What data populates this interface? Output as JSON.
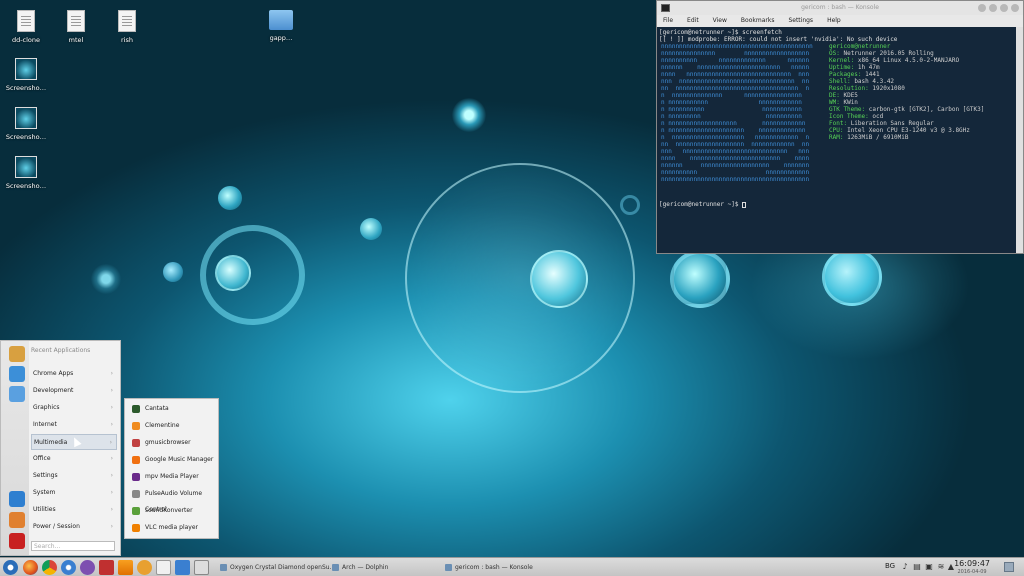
{
  "desktop": {
    "icons": [
      {
        "label": "dd-clone",
        "kind": "document"
      },
      {
        "label": "mtel",
        "kind": "document"
      },
      {
        "label": "rish",
        "kind": "document"
      },
      {
        "label": "gapp…",
        "kind": "folder"
      },
      {
        "label": "Screensho…",
        "kind": "screenshot"
      },
      {
        "label": "Screensho…",
        "kind": "screenshot"
      },
      {
        "label": "Screensho…",
        "kind": "screenshot"
      }
    ]
  },
  "konsole": {
    "title": "gericom : bash — Konsole",
    "menu": [
      "File",
      "Edit",
      "View",
      "Bookmarks",
      "Settings",
      "Help"
    ],
    "prompt_line": "[gericom@netrunner ~]$ screenfetch",
    "error_line": "[[ ! ]] modprobe: ERROR: could not insert 'nvidia': No such device",
    "user_host": "gericom@netrunner",
    "info": [
      {
        "key": "OS:",
        "value": "Netrunner 2016.05 Rolling"
      },
      {
        "key": "Kernel:",
        "value": "x86_64 Linux 4.5.0-2-MANJARO"
      },
      {
        "key": "Uptime:",
        "value": "1h 47m"
      },
      {
        "key": "Packages:",
        "value": "1441"
      },
      {
        "key": "Shell:",
        "value": "bash 4.3.42"
      },
      {
        "key": "Resolution:",
        "value": "1920x1080"
      },
      {
        "key": "DE:",
        "value": "KDE5"
      },
      {
        "key": "WM:",
        "value": "KWin"
      },
      {
        "key": "GTK Theme:",
        "value": "carbon-gtk [GTK2], Carbon [GTK3]"
      },
      {
        "key": "Icon Theme:",
        "value": "ocd"
      },
      {
        "key": "Font:",
        "value": "Liberation Sans Regular"
      },
      {
        "key": "CPU:",
        "value": "Intel Xeon CPU E3-1240 v3 @ 3.8GHz"
      },
      {
        "key": "RAM:",
        "value": "1263MiB / 6910MiB"
      }
    ],
    "final_prompt": "[gericom@netrunner ~]$ "
  },
  "startmenu": {
    "header": "Recent Applications",
    "items": [
      "Chrome Apps",
      "Development",
      "Graphics",
      "Internet",
      "Multimedia",
      "Office",
      "Settings",
      "System",
      "Utilities",
      "Power / Session"
    ],
    "selected": "Multimedia",
    "search_placeholder": "Search...",
    "icon_colors": [
      "#d8a040",
      "#3c8fd8",
      "#5aa0e0",
      "#2e7fd0",
      "#e08030",
      "#c82020"
    ]
  },
  "submenu": {
    "items": [
      {
        "label": "Cantata",
        "color": "#2c5a2c"
      },
      {
        "label": "Clementine",
        "color": "#f08c20"
      },
      {
        "label": "gmusicbrowser",
        "color": "#c04040"
      },
      {
        "label": "Google Music Manager",
        "color": "#f07010"
      },
      {
        "label": "mpv Media Player",
        "color": "#6a2a8a"
      },
      {
        "label": "PulseAudio Volume Control",
        "color": "#888888"
      },
      {
        "label": "soundKonverter",
        "color": "#5aa03a"
      },
      {
        "label": "VLC media player",
        "color": "#f08000"
      }
    ]
  },
  "taskbar": {
    "launchers": [
      "kde-menu-icon",
      "firefox-icon",
      "chrome-icon",
      "dolphin-icon",
      "viber-icon",
      "game-icon",
      "vlc-icon",
      "gimp-icon",
      "text-editor-icon",
      "downloader-icon",
      "home-icon"
    ],
    "tasks": [
      "Oxygen Crystal Diamond openSu...",
      "Arch — Dolphin",
      "gericom : bash — Konsole"
    ],
    "keyboard_layout": "BG",
    "time": "16:09:47",
    "date": "2016-04-09"
  }
}
